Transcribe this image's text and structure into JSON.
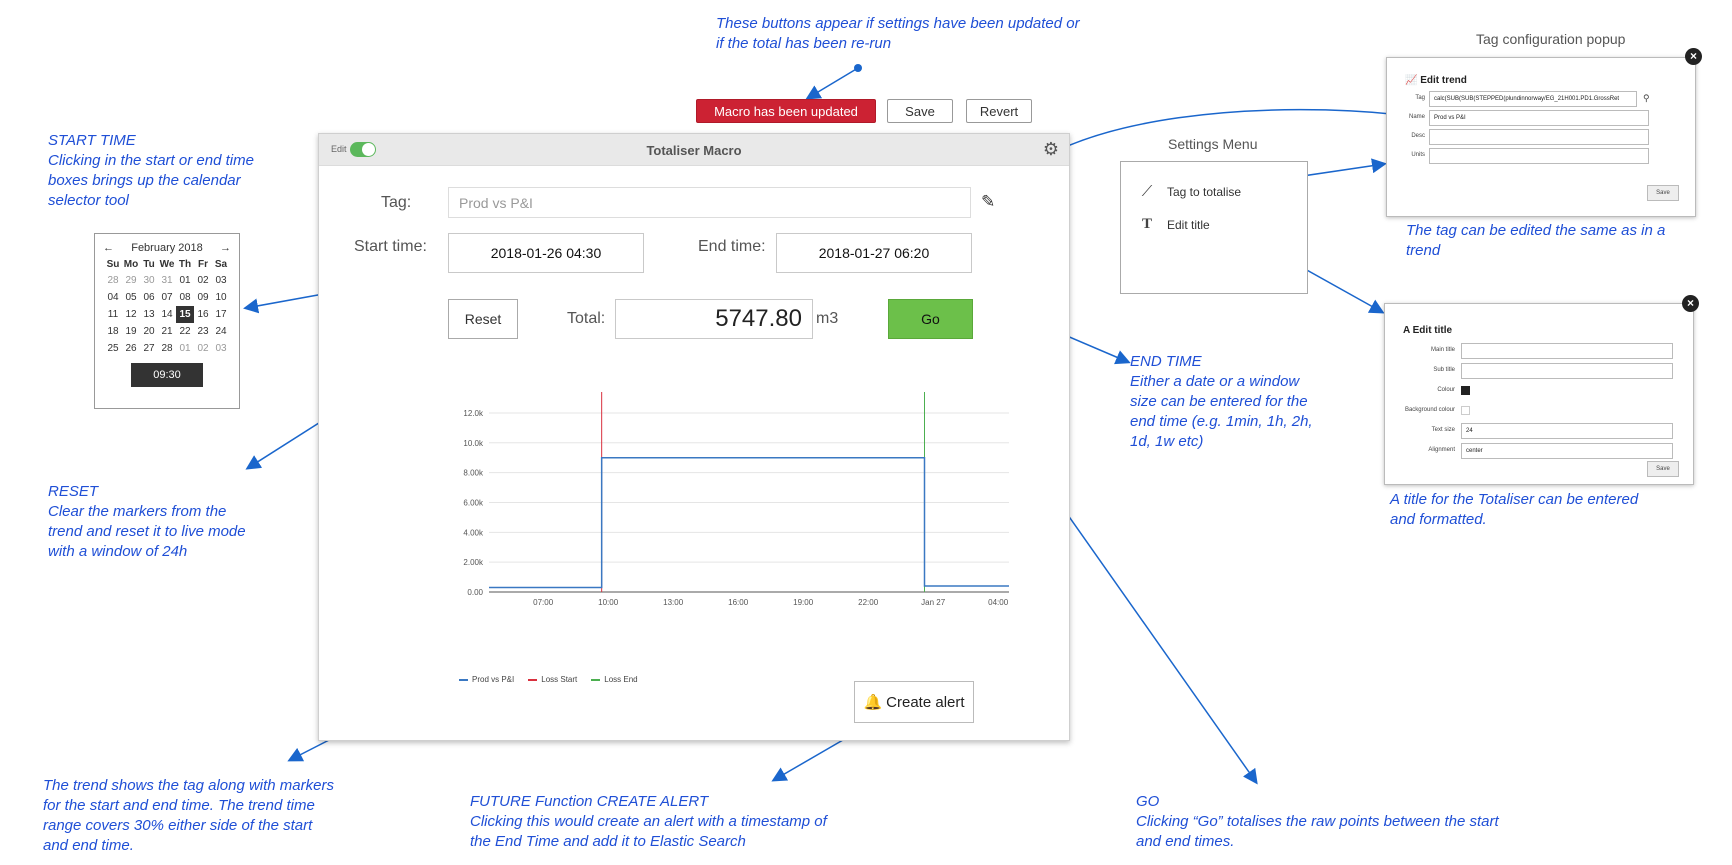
{
  "notes": {
    "buttons_appear": [
      "These buttons appear if settings have been updated or",
      "if the total has been re-run"
    ],
    "start_time": [
      "START TIME",
      "Clicking in the start or end time",
      "boxes brings up the calendar",
      "selector tool"
    ],
    "reset": [
      "RESET",
      "Clear the markers from the",
      "trend and reset it to live mode",
      "with a window of 24h"
    ],
    "trend": [
      "The trend shows the tag along with markers",
      "for the start and end time.  The trend time",
      "range covers 30% either side of the start",
      "and end time."
    ],
    "future": [
      "FUTURE Function CREATE ALERT",
      "Clicking this would create an alert with a timestamp of",
      "the End Time and add it to Elastic Search"
    ],
    "go": [
      "GO",
      "Clicking “Go” totalises the raw points between the start",
      "and end times."
    ],
    "end_time": [
      "END TIME",
      "Either a date or a window",
      "size can be entered for the",
      "end time (e.g. 1min, 1h, 2h,",
      "1d, 1w etc)"
    ],
    "tag_edit": [
      "The tag can be edited the same as in a",
      "trend"
    ],
    "title_edit": [
      "A title for the Totaliser can be entered",
      "and formatted."
    ]
  },
  "top_bar": {
    "updated_label": "Macro has been updated",
    "save_label": "Save",
    "revert_label": "Revert"
  },
  "macro": {
    "edit_label": "Edit",
    "title": "Totaliser Macro",
    "tag_label": "Tag:",
    "tag_value": "Prod vs P&I",
    "start_label": "Start time:",
    "start_value": "2018-01-26 04:30",
    "end_label": "End time:",
    "end_value": "2018-01-27 06:20",
    "reset_label": "Reset",
    "total_label": "Total:",
    "total_value": "5747.80",
    "unit": "m3",
    "go_label": "Go",
    "create_alert_label": "Create alert"
  },
  "chart_data": {
    "type": "line",
    "x_ticks": [
      "07:00",
      "10:00",
      "13:00",
      "16:00",
      "19:00",
      "22:00",
      "Jan 27",
      "04:00"
    ],
    "y_ticks": [
      "0.00",
      "2.00k",
      "4.00k",
      "6.00k",
      "8.00k",
      "10.0k",
      "12.0k"
    ],
    "ylim": [
      0,
      12600
    ],
    "xlim_hours": [
      4.5,
      28.5
    ],
    "series": [
      {
        "name": "Prod vs P&I",
        "color": "#3a78c2",
        "points": [
          [
            4.5,
            300
          ],
          [
            9.7,
            300
          ],
          [
            9.7,
            9000
          ],
          [
            24.6,
            9000
          ],
          [
            24.6,
            400
          ],
          [
            28.5,
            400
          ]
        ]
      },
      {
        "name": "Loss Start",
        "color": "#d9303e",
        "x": 9.7
      },
      {
        "name": "Loss End",
        "color": "#4caf50",
        "x": 24.6
      }
    ]
  },
  "calendar": {
    "month": "February 2018",
    "prev": "←",
    "next": "→",
    "days": [
      "Su",
      "Mo",
      "Tu",
      "We",
      "Th",
      "Fr",
      "Sa"
    ],
    "weeks": [
      [
        "28",
        "29",
        "30",
        "31",
        "01",
        "02",
        "03"
      ],
      [
        "04",
        "05",
        "06",
        "07",
        "08",
        "09",
        "10"
      ],
      [
        "11",
        "12",
        "13",
        "14",
        "15",
        "16",
        "17"
      ],
      [
        "18",
        "19",
        "20",
        "21",
        "22",
        "23",
        "24"
      ],
      [
        "25",
        "26",
        "27",
        "28",
        "01",
        "02",
        "03"
      ]
    ],
    "selected": "15",
    "time": "09:30"
  },
  "settings": {
    "title": "Settings Menu",
    "items": [
      {
        "label": "Tag to totalise",
        "icon": "line-chart-icon"
      },
      {
        "label": "Edit title",
        "icon": "text-icon"
      }
    ]
  },
  "tag_popup": {
    "caption": "Tag configuration popup",
    "title": "Edit trend",
    "rows": [
      {
        "label": "Tag",
        "value": "calc(SUB(SUB(STEPPED(plundinnorway/EG_21H001.PD1.GrossRet"
      },
      {
        "label": "Name",
        "value": "Prod vs P&I"
      },
      {
        "label": "Desc",
        "value": ""
      },
      {
        "label": "Units",
        "value": ""
      }
    ],
    "save_label": "Save"
  },
  "title_popup": {
    "title": "Edit title",
    "rows": [
      {
        "label": "Main title",
        "value": ""
      },
      {
        "label": "Sub title",
        "value": ""
      },
      {
        "label": "Colour",
        "value": ""
      },
      {
        "label": "Background colour",
        "value": ""
      },
      {
        "label": "Text size",
        "value": "24"
      },
      {
        "label": "Alignment",
        "value": "center"
      }
    ],
    "save_label": "Save"
  }
}
